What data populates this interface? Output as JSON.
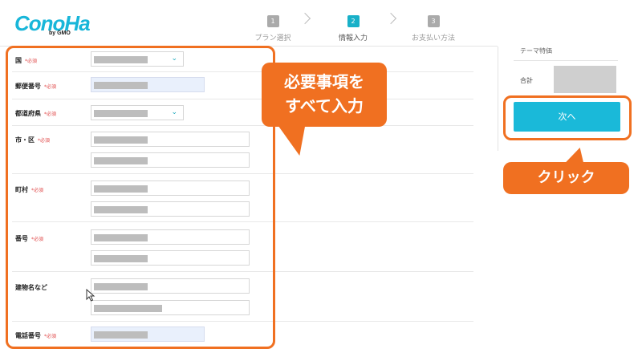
{
  "logo": {
    "text": "ConoHa",
    "sub": "by GMO"
  },
  "steps": [
    {
      "num": "1",
      "label": "プラン選択"
    },
    {
      "num": "2",
      "label": "情報入力"
    },
    {
      "num": "3",
      "label": "お支払い方法"
    }
  ],
  "form": {
    "required_mark": "*必須",
    "country_label": "国",
    "postal_label": "郵便番号",
    "prefecture_label": "都道府県",
    "city_label": "市・区",
    "town_label": "町村",
    "address_label": "番号",
    "building_label": "建物名など",
    "phone_label": "電話番号"
  },
  "callout_main": {
    "line1": "必要事項を",
    "line2": "すべて入力"
  },
  "side": {
    "top_text": "テーマ特価",
    "total_label": "合計",
    "next_label": "次へ"
  },
  "callout_click": "クリック",
  "colors": {
    "accent": "#1ab9d9",
    "annotation": "#f07021",
    "required": "#e04a4a"
  }
}
